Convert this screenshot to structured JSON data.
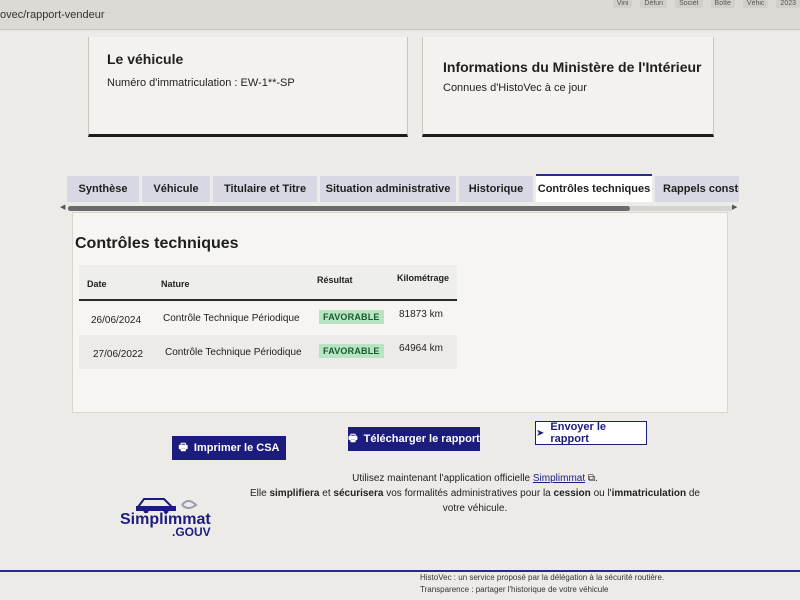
{
  "browser": {
    "url": "ovec/rapport-vendeur",
    "bookmarks": [
      "Vini",
      "Défun",
      "Sociét",
      "Boîte",
      "Véhic",
      "2023"
    ]
  },
  "vehicle_card": {
    "title": "Le véhicule",
    "plate_line": "Numéro d'immatriculation : EW-1**-SP"
  },
  "ministry_card": {
    "title": "Informations du Ministère de l'Intérieur",
    "subtitle": "Connues d'HistoVec à ce jour"
  },
  "tabs": [
    {
      "label": "Synthèse",
      "active": false
    },
    {
      "label": "Véhicule",
      "active": false
    },
    {
      "label": "Titulaire et Titre",
      "active": false
    },
    {
      "label": "Situation administrative",
      "active": false
    },
    {
      "label": "Historique",
      "active": false
    },
    {
      "label": "Contrôles techniques",
      "active": true
    },
    {
      "label": "Rappels constructeur",
      "active": false
    }
  ],
  "panel": {
    "title": "Contrôles techniques",
    "columns": [
      "Date",
      "Nature",
      "Résultat",
      "Kilométrage"
    ],
    "rows": [
      {
        "date": "26/06/2024",
        "nature": "Contrôle Technique Périodique",
        "result": "FAVORABLE",
        "mileage": "81873 km"
      },
      {
        "date": "27/06/2022",
        "nature": "Contrôle Technique Périodique",
        "result": "FAVORABLE",
        "mileage": "64964 km"
      }
    ]
  },
  "actions": {
    "print": "Imprimer le CSA",
    "download": "Télécharger le rapport",
    "send": "Envoyer le rapport"
  },
  "simplimmat": {
    "line1_prefix": "Utilisez maintenant l'application officielle",
    "link": "Simplimmat",
    "line2_a": "Elle",
    "line2_b": "simplifiera",
    "line2_c": "et",
    "line2_d": "sécurisera",
    "line2_e": "vos formalités administratives pour la",
    "line2_f": "cession",
    "line2_g": "ou l'",
    "line2_h": "immatriculation",
    "line2_i": "de",
    "line3": "votre véhicule.",
    "logo_word": "Simplimmat",
    "logo_sub": ".GOUV"
  },
  "footer": {
    "line1": "HistoVec : un service proposé par la délégation à la sécurité routière.",
    "line2": "Transparence : partager l'historique de votre véhicule"
  },
  "colors": {
    "primary": "#1c1c7e",
    "badge_bg": "#b8e4c3",
    "badge_text": "#185a2b"
  }
}
